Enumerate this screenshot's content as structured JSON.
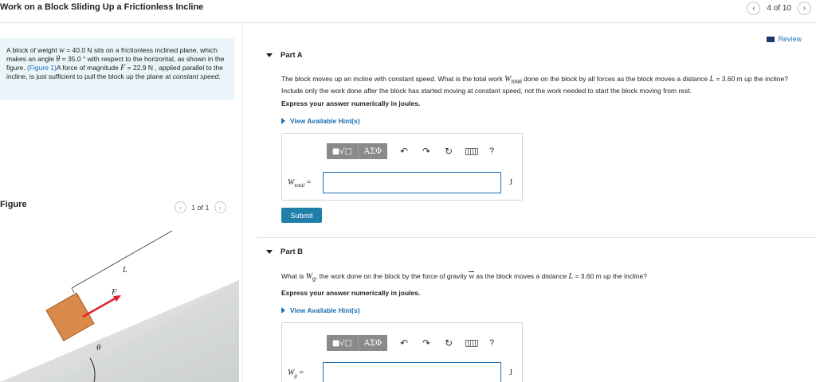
{
  "header": {
    "title": "Work on a Block Sliding Up a Frictionless Incline",
    "page_count": "4 of 10",
    "prev_icon": "chevron-left-icon",
    "next_icon": "chevron-right-icon"
  },
  "problem": {
    "p1": "A block of weight ",
    "w_sym": "w",
    "p2": " = 40.0 N sits on a frictionless inclined plane, which makes an angle ",
    "theta_sym": "θ",
    "p3": " = 35.0 ° with respect to the horizontal, as shown in the figure. ",
    "figure_link": "(Figure 1)",
    "p4": "A force of magnitude ",
    "F_sym": "F",
    "p5": " = 22.9 N , applied parallel to the incline, is just sufficient to pull the block up the plane at ",
    "italic_tail": "constant speed",
    "p6": "."
  },
  "figure": {
    "label": "Figure",
    "count": "1 of 1",
    "label_L": "L",
    "label_F": "F",
    "label_theta": "θ",
    "block_color": "#d98a4a",
    "arrow_color": "#e0202c"
  },
  "review": {
    "label": "Review"
  },
  "partA": {
    "title": "Part A",
    "q1": "The block moves up an incline with constant speed. What is the total work ",
    "q_sym": "W",
    "q_sub": "total",
    "q2": " done on the block by all forces as the block moves a distance ",
    "L_sym": "L",
    "q3": " = 3.60 m up the incline? Include only the work done after the block has started moving at constant speed, not the work needed to start the block moving from rest.",
    "instruction": "Express your answer numerically in joules.",
    "hints": "View Available Hint(s)",
    "var_main": "W",
    "var_sub": "total",
    "equals": "=",
    "input_value": "",
    "unit": "J",
    "submit": "Submit"
  },
  "partB": {
    "title": "Part B",
    "q1": "What is ",
    "q_sym": "W",
    "q_sub": "g",
    "q2": ", the work done on the block by the force of gravity ",
    "w_sym": "w",
    "q3": " as the block moves a distance ",
    "L_sym": "L",
    "q4": " = 3.60 m up the incline?",
    "instruction": "Express your answer numerically in joules.",
    "hints": "View Available Hint(s)",
    "var_main": "W",
    "var_sub": "g",
    "equals": "=",
    "input_value": "",
    "unit": "J"
  },
  "toolbar": {
    "sqrt": "■√□",
    "greek": "ΑΣΦ",
    "undo": "↶",
    "redo": "↷",
    "reset": "↻",
    "help": "?"
  }
}
